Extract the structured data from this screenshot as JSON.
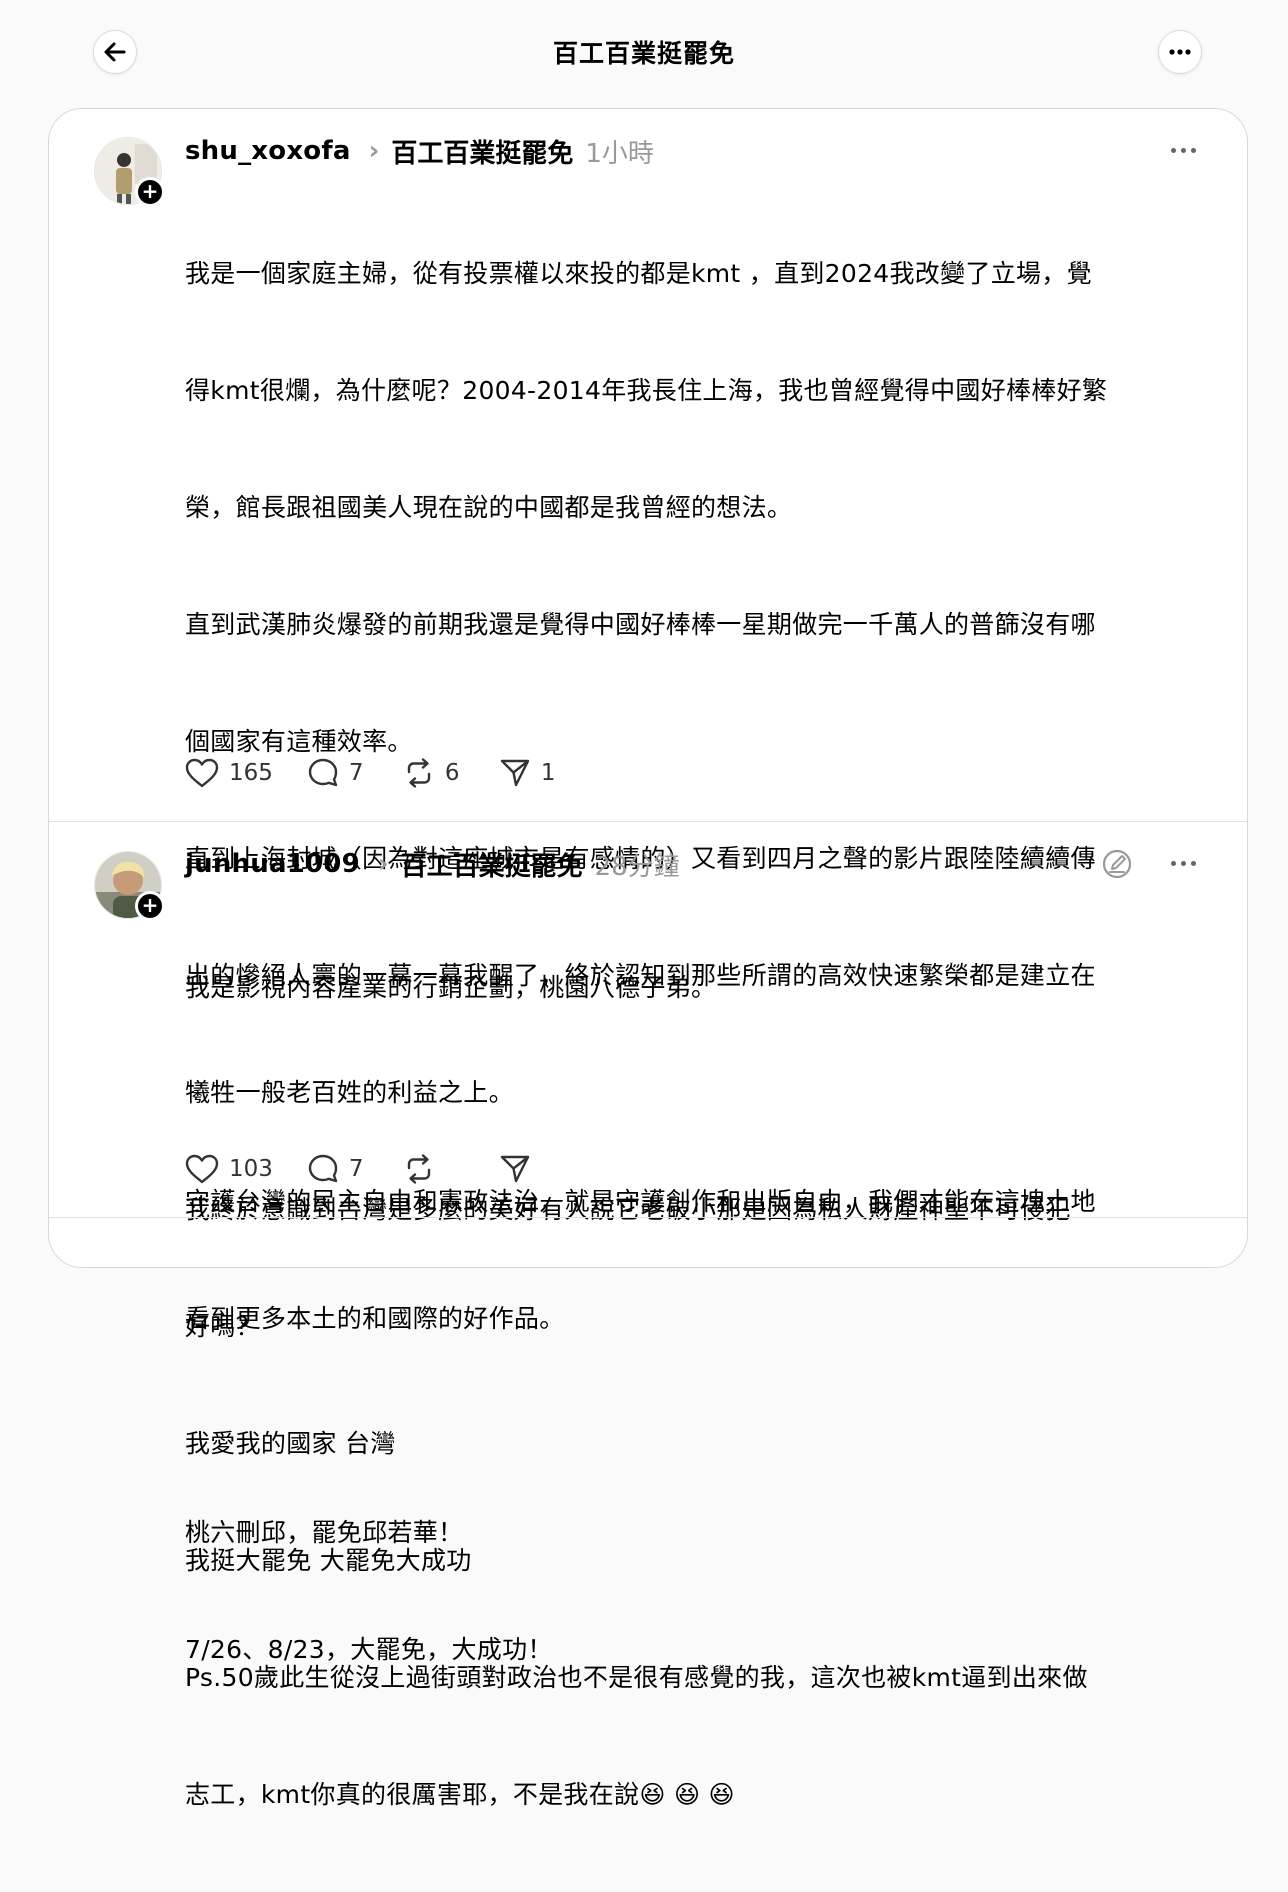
{
  "header": {
    "title": "百工百業挺罷免",
    "back_icon": "arrow-left-icon",
    "more_icon": "ellipsis-icon"
  },
  "posts": [
    {
      "username": "shu_xoxofa",
      "community": "百工百業挺罷免",
      "time": "1小時",
      "lines": [
        "我是一個家庭主婦，從有投票權以來投的都是kmt ，直到2024我改變了立場，覺",
        "得kmt很爛，為什麼呢？2004-2014年我長住上海，我也曾經覺得中國好棒棒好繁",
        "榮，館長跟祖國美人現在說的中國都是我曾經的想法。",
        "直到武漢肺炎爆發的前期我還是覺得中國好棒棒一星期做完一千萬人的普篩沒有哪",
        "個國家有這種效率。",
        "直到上海封城（因為對這座城市是有感情的）又看到四月之聲的影片跟陸陸續續傳",
        "出的慘絕人寰的一幕一幕我醒了，終於認知到那些所謂的高效快速繁榮都是建立在",
        "犧牲一般老百姓的利益之上。",
        "我終於意識到台灣是多麼的美好有人說它老破小那是因為私人財產神聖不可侵犯",
        "好嗎？",
        "我愛我的國家 台灣",
        "我挺大罷免 大罷免大成功",
        "Ps.50歲此生從沒上過街頭對政治也不是很有感覺的我，這次也被kmt逼到出來做",
        "志工，kmt你真的很厲害耶，不是我在說😆 😆 😆"
      ],
      "likes": "165",
      "replies": "7",
      "reposts": "6",
      "shares": "1"
    },
    {
      "username": "junhua1009",
      "community": "百工百業挺罷免",
      "time": "28分鐘",
      "lines": [
        "我是影視內容產業的行銷企劃，桃園八德子弟。",
        "",
        "守護台灣的民主自由和憲政法治，就是守護創作和出版自由，我們才能在這塊土地",
        "看到更多本土的和國際的好作品。",
        "",
        "桃六刪邱，罷免邱若華！",
        "7/26、8/23，大罷免，大成功！"
      ],
      "likes": "103",
      "replies": "7",
      "reposts": "",
      "shares": ""
    }
  ],
  "colors": {
    "background": "#fafafa",
    "card": "#ffffff",
    "secondary_text": "#999999",
    "text": "#000000"
  }
}
